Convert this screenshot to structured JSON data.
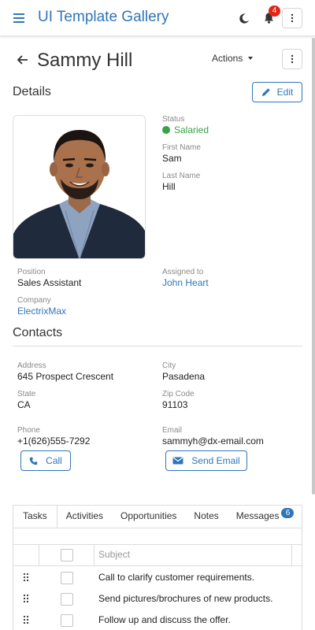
{
  "app": {
    "title": "UI Template Gallery",
    "notification_count": "4"
  },
  "page": {
    "name": "Sammy Hill",
    "actions_label": "Actions"
  },
  "details": {
    "title": "Details",
    "edit_label": "Edit",
    "status_label": "Status",
    "status_value": "Salaried",
    "first_name_label": "First Name",
    "first_name": "Sam",
    "last_name_label": "Last Name",
    "last_name": "Hill",
    "position_label": "Position",
    "position": "Sales Assistant",
    "assigned_label": "Assigned to",
    "assigned": "John Heart",
    "company_label": "Company",
    "company": "ElectrixMax"
  },
  "contacts": {
    "title": "Contacts",
    "address_label": "Address",
    "address": "645 Prospect Crescent",
    "city_label": "City",
    "city": "Pasadena",
    "state_label": "State",
    "state": "CA",
    "zip_label": "Zip Code",
    "zip": "91103",
    "phone_label": "Phone",
    "phone": "+1(626)555-7292",
    "email_label": "Email",
    "email": "sammyh@dx-email.com",
    "call_label": "Call",
    "send_email_label": "Send Email"
  },
  "tabs": [
    {
      "label": "Tasks"
    },
    {
      "label": "Activities"
    },
    {
      "label": "Opportunities"
    },
    {
      "label": "Notes"
    },
    {
      "label": "Messages",
      "badge": "6"
    }
  ],
  "tasks": {
    "subject_header": "Subject",
    "rows": [
      "Call to clarify customer requirements.",
      "Send pictures/brochures of new products.",
      "Follow up and discuss the offer."
    ]
  },
  "colors": {
    "accent": "#2f76b8",
    "status_green": "#3aa244",
    "badge_red": "#e52416"
  }
}
